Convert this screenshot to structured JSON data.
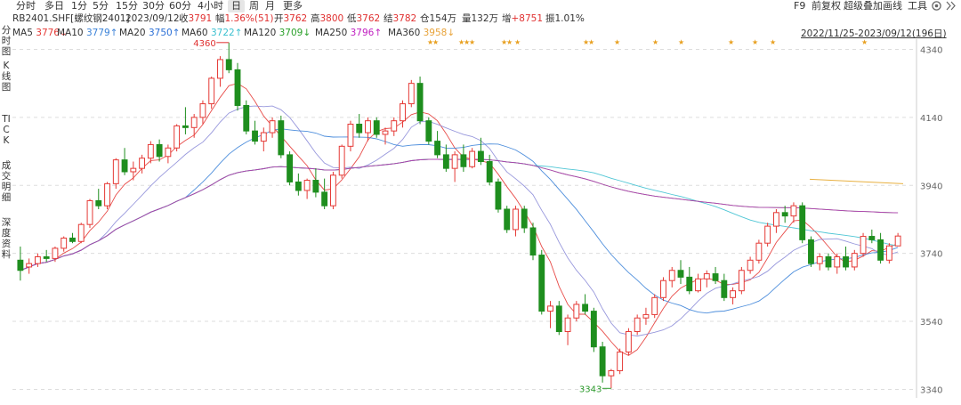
{
  "periods": [
    {
      "label": "分时",
      "active": false
    },
    {
      "label": "多日",
      "active": false
    },
    {
      "label": "1分",
      "active": false
    },
    {
      "label": "5分",
      "active": false
    },
    {
      "label": "15分",
      "active": false
    },
    {
      "label": "30分",
      "active": false
    },
    {
      "label": "60分",
      "active": false
    },
    {
      "label": "4小时",
      "active": false
    },
    {
      "label": "日",
      "active": true
    },
    {
      "label": "周",
      "active": false
    },
    {
      "label": "月",
      "active": false
    },
    {
      "label": "更多",
      "active": false
    }
  ],
  "toolbar": {
    "f9": "F9",
    "fq": "前复权",
    "overlay": "超级叠加",
    "draw": "画线",
    "tools": "工具"
  },
  "info": {
    "symbol": "RB2401.SHF[螺纹钢2401]",
    "date": "2023/09/12",
    "close_label": "收",
    "close": "3791",
    "chg_label": "幅",
    "chg": "1.36%(51)",
    "open_label": "开",
    "open": "3762",
    "high_label": "高",
    "high": "3800",
    "low_label": "低",
    "low": "3762",
    "settle_label": "结",
    "settle": "3782",
    "oi_label": "仓",
    "oi": "154万",
    "vol_label": "量",
    "vol": "132万",
    "inc_label": "增",
    "inc": "+8751",
    "amp_label": "振",
    "amp": "1.01%"
  },
  "ma": [
    {
      "label": "MA5",
      "value": "3776",
      "arrow": "↓",
      "color": "#e53935"
    },
    {
      "label": "MA10",
      "value": "3779",
      "arrow": "↑",
      "color": "#3a82d8"
    },
    {
      "label": "MA20",
      "value": "3750",
      "arrow": "↑",
      "color": "#2a6fd6"
    },
    {
      "label": "MA60",
      "value": "3722",
      "arrow": "↑",
      "color": "#3cc0d0"
    },
    {
      "label": "MA120",
      "value": "3709",
      "arrow": "↓",
      "color": "#2aa02a"
    },
    {
      "label": "MA250",
      "value": "3796",
      "arrow": "↑",
      "color": "#c020c0"
    },
    {
      "label": "MA360",
      "value": "3958",
      "arrow": "↓",
      "color": "#e8a33a"
    }
  ],
  "left_tabs": [
    {
      "label": "分时图"
    },
    {
      "label": "K线图"
    },
    {
      "label": "TICK"
    },
    {
      "label": "成交明细"
    },
    {
      "label": "深度资料"
    }
  ],
  "date_range": "2022/11/25-2023/09/12(196日)",
  "icons": {
    "settings": "gear-icon",
    "collapse": "chevron-double-right-icon"
  },
  "colors": {
    "up": "#e53935",
    "down": "#1e8e1e",
    "grid": "#dddddd"
  },
  "chart_data": {
    "type": "candlestick",
    "y_ticks": [
      3340,
      3540,
      3740,
      3940,
      4140,
      4340
    ],
    "ylim": [
      3315,
      4370
    ],
    "high_label": "4360",
    "low_label": "3343",
    "ohlc": [
      [
        3720,
        3760,
        3660,
        3690
      ],
      [
        3700,
        3725,
        3680,
        3710
      ],
      [
        3710,
        3740,
        3700,
        3730
      ],
      [
        3730,
        3750,
        3715,
        3725
      ],
      [
        3725,
        3760,
        3715,
        3755
      ],
      [
        3755,
        3790,
        3745,
        3785
      ],
      [
        3785,
        3800,
        3770,
        3775
      ],
      [
        3775,
        3830,
        3770,
        3825
      ],
      [
        3825,
        3900,
        3815,
        3895
      ],
      [
        3895,
        3930,
        3870,
        3880
      ],
      [
        3880,
        3950,
        3870,
        3945
      ],
      [
        3945,
        4020,
        3930,
        4015
      ],
      [
        4015,
        4050,
        3970,
        3980
      ],
      [
        3980,
        4010,
        3955,
        3990
      ],
      [
        3990,
        4030,
        3975,
        4020
      ],
      [
        4020,
        4070,
        4005,
        4060
      ],
      [
        4060,
        4075,
        4010,
        4025
      ],
      [
        4025,
        4060,
        4005,
        4050
      ],
      [
        4050,
        4120,
        4040,
        4115
      ],
      [
        4115,
        4170,
        4090,
        4110
      ],
      [
        4110,
        4150,
        4080,
        4140
      ],
      [
        4140,
        4190,
        4120,
        4180
      ],
      [
        4180,
        4260,
        4165,
        4255
      ],
      [
        4255,
        4320,
        4230,
        4310
      ],
      [
        4310,
        4360,
        4270,
        4280
      ],
      [
        4280,
        4300,
        4160,
        4175
      ],
      [
        4175,
        4190,
        4090,
        4100
      ],
      [
        4100,
        4130,
        4060,
        4070
      ],
      [
        4070,
        4110,
        4040,
        4095
      ],
      [
        4095,
        4140,
        4080,
        4130
      ],
      [
        4130,
        4145,
        4020,
        4030
      ],
      [
        4030,
        4040,
        3940,
        3950
      ],
      [
        3950,
        3975,
        3910,
        3925
      ],
      [
        3925,
        3960,
        3900,
        3955
      ],
      [
        3955,
        3990,
        3905,
        3920
      ],
      [
        3920,
        3960,
        3870,
        3880
      ],
      [
        3880,
        3980,
        3870,
        3970
      ],
      [
        3970,
        4060,
        3960,
        4055
      ],
      [
        4055,
        4130,
        4040,
        4120
      ],
      [
        4120,
        4150,
        4080,
        4095
      ],
      [
        4095,
        4140,
        4070,
        4130
      ],
      [
        4130,
        4140,
        4080,
        4090
      ],
      [
        4090,
        4110,
        4060,
        4100
      ],
      [
        4100,
        4140,
        4085,
        4130
      ],
      [
        4130,
        4190,
        4110,
        4180
      ],
      [
        4180,
        4250,
        4170,
        4240
      ],
      [
        4240,
        4260,
        4120,
        4130
      ],
      [
        4130,
        4140,
        4060,
        4070
      ],
      [
        4070,
        4100,
        4020,
        4030
      ],
      [
        4030,
        4060,
        3980,
        3990
      ],
      [
        3990,
        4040,
        3950,
        4030
      ],
      [
        4030,
        4060,
        3980,
        3995
      ],
      [
        3995,
        4050,
        3990,
        4040
      ],
      [
        4040,
        4080,
        4000,
        4010
      ],
      [
        4010,
        4030,
        3940,
        3950
      ],
      [
        3950,
        3960,
        3860,
        3870
      ],
      [
        3870,
        3880,
        3800,
        3810
      ],
      [
        3810,
        3880,
        3790,
        3870
      ],
      [
        3870,
        3880,
        3800,
        3815
      ],
      [
        3815,
        3830,
        3720,
        3735
      ],
      [
        3735,
        3750,
        3560,
        3570
      ],
      [
        3570,
        3600,
        3520,
        3585
      ],
      [
        3585,
        3600,
        3500,
        3510
      ],
      [
        3510,
        3560,
        3470,
        3550
      ],
      [
        3550,
        3600,
        3540,
        3590
      ],
      [
        3590,
        3620,
        3560,
        3570
      ],
      [
        3570,
        3580,
        3450,
        3465
      ],
      [
        3465,
        3480,
        3360,
        3380
      ],
      [
        3380,
        3400,
        3343,
        3395
      ],
      [
        3395,
        3460,
        3385,
        3450
      ],
      [
        3450,
        3520,
        3440,
        3510
      ],
      [
        3510,
        3560,
        3500,
        3550
      ],
      [
        3550,
        3580,
        3530,
        3560
      ],
      [
        3560,
        3620,
        3550,
        3610
      ],
      [
        3610,
        3670,
        3600,
        3660
      ],
      [
        3660,
        3700,
        3640,
        3690
      ],
      [
        3690,
        3720,
        3650,
        3670
      ],
      [
        3670,
        3700,
        3620,
        3630
      ],
      [
        3630,
        3680,
        3625,
        3665
      ],
      [
        3665,
        3690,
        3640,
        3680
      ],
      [
        3680,
        3700,
        3650,
        3660
      ],
      [
        3660,
        3680,
        3600,
        3610
      ],
      [
        3610,
        3640,
        3590,
        3630
      ],
      [
        3630,
        3700,
        3620,
        3690
      ],
      [
        3690,
        3730,
        3680,
        3720
      ],
      [
        3720,
        3780,
        3710,
        3770
      ],
      [
        3770,
        3830,
        3760,
        3820
      ],
      [
        3820,
        3870,
        3800,
        3860
      ],
      [
        3860,
        3880,
        3830,
        3850
      ],
      [
        3850,
        3890,
        3830,
        3880
      ],
      [
        3880,
        3890,
        3770,
        3780
      ],
      [
        3780,
        3790,
        3700,
        3710
      ],
      [
        3710,
        3740,
        3690,
        3730
      ],
      [
        3730,
        3740,
        3690,
        3700
      ],
      [
        3700,
        3740,
        3680,
        3730
      ],
      [
        3730,
        3760,
        3690,
        3700
      ],
      [
        3700,
        3750,
        3690,
        3740
      ],
      [
        3740,
        3800,
        3730,
        3790
      ],
      [
        3790,
        3810,
        3770,
        3780
      ],
      [
        3780,
        3800,
        3710,
        3720
      ],
      [
        3720,
        3770,
        3710,
        3762
      ],
      [
        3762,
        3800,
        3762,
        3791
      ]
    ]
  }
}
